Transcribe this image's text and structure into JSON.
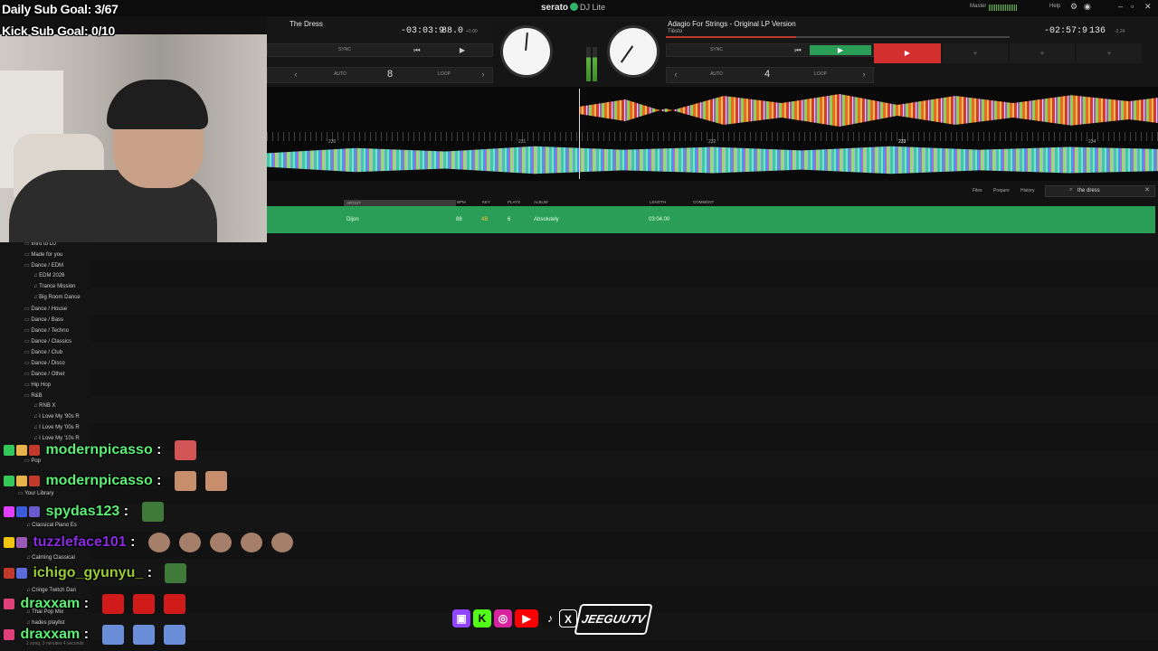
{
  "app": {
    "brand": "serato",
    "edition": "DJ Lite"
  },
  "topbar": {
    "master": "Master",
    "help": "Help"
  },
  "deck1": {
    "title": "The Dress",
    "time_remaining": "-03:03:9",
    "bpm": "88.0",
    "pitch": "+0.00",
    "sync": "SYNC",
    "auto": "AUTO",
    "loop": "LOOP",
    "beatjump": "8"
  },
  "deck2": {
    "title": "Adagio For Strings - Original LP Version",
    "artist": "Tiësto",
    "time_remaining": "-02:57:9",
    "bpm": "136",
    "pitch": "-2.24",
    "sync": "SYNC",
    "auto": "AUTO",
    "loop": "LOOP",
    "beatjump": "4",
    "pads": [
      "+",
      "+",
      "+"
    ]
  },
  "waveform": {
    "markers": [
      "230",
      "231",
      "232",
      "233",
      "234"
    ]
  },
  "library": {
    "tabs": [
      "Files",
      "Prepare",
      "History"
    ],
    "search_value": "the dress",
    "columns": [
      "ARTIST",
      "BPM",
      "KEY",
      "PLAYS",
      "ALBUM",
      "LENGTH",
      "COMMENT"
    ],
    "rows": [
      {
        "artist": "Dijon",
        "bpm": "88",
        "key": "4B",
        "plays": "6",
        "album": "Absolutely",
        "length": "03:04.00",
        "comment": ""
      }
    ],
    "footer": "1 song, 3 minutes 4 seconds"
  },
  "sidebar": {
    "items": [
      {
        "label": "Intro to DJ",
        "type": "folder"
      },
      {
        "label": "Made for you",
        "type": "folder"
      },
      {
        "label": "Dance / EDM",
        "type": "folder"
      },
      {
        "label": "EDM 2026",
        "type": "note"
      },
      {
        "label": "Trance Mission",
        "type": "note"
      },
      {
        "label": "Big Room Dance",
        "type": "note"
      },
      {
        "label": "Dance / House",
        "type": "folder"
      },
      {
        "label": "Dance / Bass",
        "type": "folder"
      },
      {
        "label": "Dance / Techno",
        "type": "folder"
      },
      {
        "label": "Dance / Classics",
        "type": "folder"
      },
      {
        "label": "Dance / Club",
        "type": "folder"
      },
      {
        "label": "Dance / Disco",
        "type": "folder"
      },
      {
        "label": "Dance / Other",
        "type": "folder"
      },
      {
        "label": "Hip Hop",
        "type": "folder"
      },
      {
        "label": "R&B",
        "type": "folder"
      },
      {
        "label": "RNB X",
        "type": "note"
      },
      {
        "label": "I Love My '90s R",
        "type": "note"
      },
      {
        "label": "I Love My '00s R",
        "type": "note"
      },
      {
        "label": "I Love My '10s R",
        "type": "note"
      },
      {
        "label": "Pop",
        "type": "folder"
      },
      {
        "label": "Your Library",
        "type": "folder"
      },
      {
        "label": "Classical Piano Es",
        "type": "note"
      },
      {
        "label": "Calming Classical",
        "type": "note"
      },
      {
        "label": "Cringe Twitch Dan",
        "type": "note"
      },
      {
        "label": "Thai Pop Mix",
        "type": "note"
      },
      {
        "label": "hades playlist",
        "type": "note"
      }
    ]
  },
  "overlay": {
    "daily_goal": "Daily Sub Goal: 3/67",
    "kick_goal": "Kick Sub Goal: 0/10",
    "chat": [
      {
        "user": "modernpicasso",
        "sep": ":",
        "color": "#5bf075"
      },
      {
        "user": "modernpicasso",
        "sep": ":",
        "color": "#5bf075"
      },
      {
        "user": "spydas123",
        "sep": ":",
        "color": "#5bf075"
      },
      {
        "user": "tuzzleface101",
        "sep": ":",
        "color": "#8a2be2"
      },
      {
        "user": "ichigo_gyunyu_",
        "sep": ":",
        "color": "#9acd32"
      },
      {
        "user": "draxxam",
        "sep": ":",
        "color": "#5bf075"
      },
      {
        "user": "draxxam",
        "sep": ":",
        "color": "#5bf075"
      }
    ],
    "handle": "JEEGUUTV"
  },
  "colors": {
    "selected_row": "#2a9d57",
    "accent_green": "#2fb36b",
    "play_red": "#d32f2f"
  }
}
